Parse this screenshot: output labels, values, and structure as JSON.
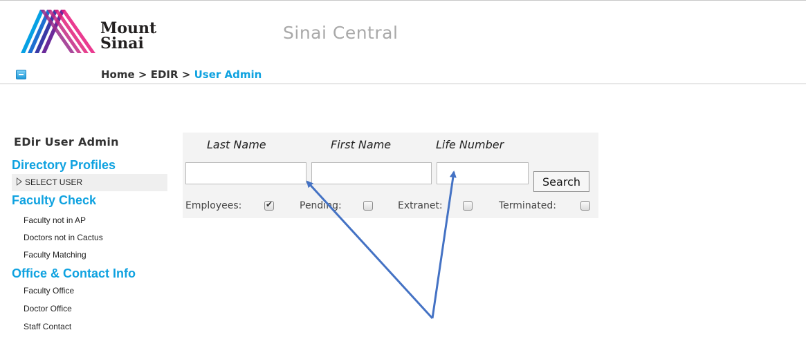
{
  "header": {
    "logo_line1": "Mount",
    "logo_line2": "Sinai",
    "app_title": "Sinai Central",
    "breadcrumb": {
      "home": "Home",
      "sep1": ">",
      "edir": "EDIR",
      "sep2": ">",
      "current": "User Admin"
    }
  },
  "sidebar": {
    "title": "EDir User Admin",
    "sections": [
      {
        "heading": "Directory Profiles",
        "items": [
          "SELECT USER"
        ]
      },
      {
        "heading": "Faculty Check",
        "items": [
          "Faculty not in AP",
          "Doctors not in Cactus",
          "Faculty Matching"
        ]
      },
      {
        "heading": "Office & Contact Info",
        "items": [
          "Faculty Office",
          "Doctor Office",
          "Staff Contact"
        ]
      }
    ]
  },
  "search": {
    "columns": {
      "last_name": "Last Name",
      "first_name": "First Name",
      "life_number": "Life Number"
    },
    "fields": {
      "last_name": "",
      "first_name": "",
      "life_number": ""
    },
    "button": "Search",
    "filters": [
      {
        "label": "Employees:",
        "checked": true
      },
      {
        "label": "Pending:",
        "checked": false
      },
      {
        "label": "Extranet:",
        "checked": false
      },
      {
        "label": "Terminated:",
        "checked": false
      }
    ]
  },
  "colors": {
    "accent": "#0fa2e0",
    "arrow": "#4472c4",
    "title_gray": "#a9a9a9"
  }
}
